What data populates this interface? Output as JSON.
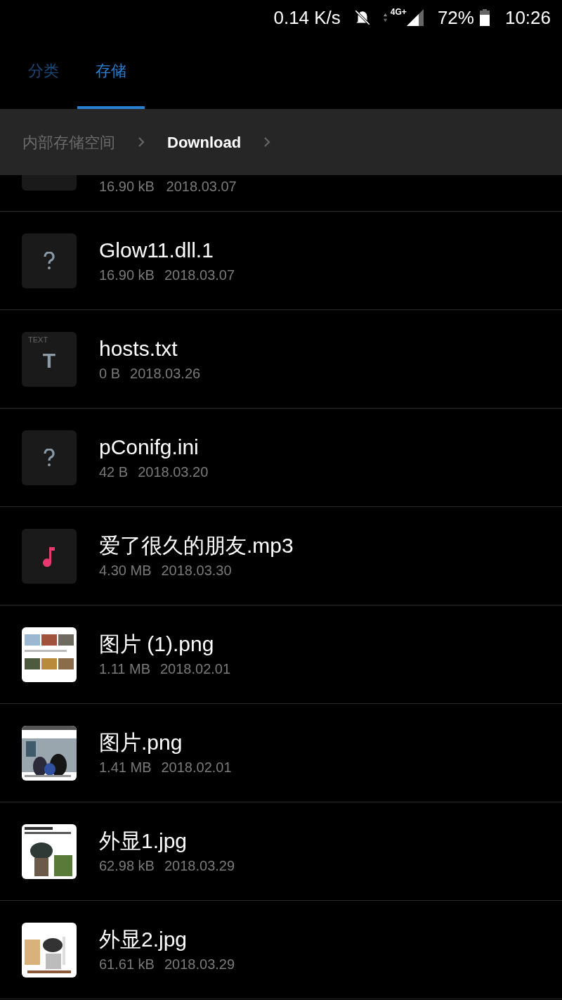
{
  "status_bar": {
    "speed": "0.14 K/s",
    "network": "4G+",
    "battery": "72%",
    "time": "10:26"
  },
  "tabs": [
    {
      "label": "分类",
      "selected": false
    },
    {
      "label": "存储",
      "selected": true
    }
  ],
  "breadcrumb": [
    {
      "label": "内部存储空间",
      "selected": false
    },
    {
      "label": "Download",
      "selected": true
    }
  ],
  "partial_file": {
    "meta": "16.90 kB   2018.03.07"
  },
  "files": [
    {
      "kind": "unknown",
      "name": "Glow11.dll.1",
      "size": "16.90 kB",
      "date": "2018.03.07"
    },
    {
      "kind": "text",
      "badge": "TEXT",
      "glyph": "T",
      "name": "hosts.txt",
      "size": "0 B",
      "date": "2018.03.26"
    },
    {
      "kind": "unknown",
      "name": "pConifg.ini",
      "size": "42 B",
      "date": "2018.03.20"
    },
    {
      "kind": "audio",
      "name": "爱了很久的朋友.mp3",
      "size": "4.30 MB",
      "date": "2018.03.30"
    },
    {
      "kind": "picture",
      "name": "图片 (1).png",
      "size": "1.11 MB",
      "date": "2018.02.01"
    },
    {
      "kind": "picture",
      "name": "图片.png",
      "size": "1.41 MB",
      "date": "2018.02.01"
    },
    {
      "kind": "picture",
      "name": "外显1.jpg",
      "size": "62.98 kB",
      "date": "2018.03.29"
    },
    {
      "kind": "picture",
      "name": "外显2.jpg",
      "size": "61.61 kB",
      "date": "2018.03.29"
    }
  ]
}
